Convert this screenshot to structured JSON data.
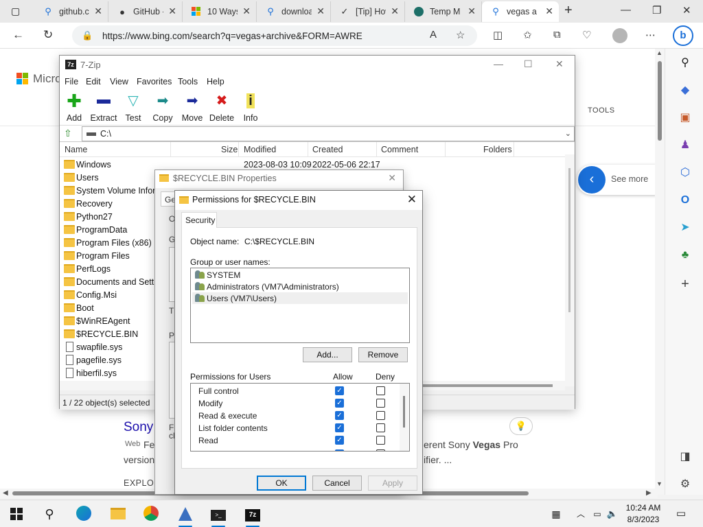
{
  "browser": {
    "tabs": [
      {
        "label": "github.com",
        "icon": "search-icon"
      },
      {
        "label": "GitHub - ",
        "icon": "github-icon"
      },
      {
        "label": "10 Ways",
        "icon": "windows-icon"
      },
      {
        "label": "download",
        "icon": "search-icon"
      },
      {
        "label": "[Tip] How",
        "icon": "tip-icon"
      },
      {
        "label": "Temp Mail",
        "icon": "tempmail-icon"
      },
      {
        "label": "vegas archive",
        "icon": "search-icon"
      }
    ],
    "new_tab_symbol": "+",
    "url": "https://www.bing.com/search?q=vegas+archive&FORM=AWRE"
  },
  "webpage": {
    "logo_text": "Micro",
    "tools_label": "TOOLS",
    "see_more": "See more",
    "result_title": "Sony",
    "result_source": "Web",
    "result_snippet_start": "Fe",
    "snippet_line1_right": "erent Sony ",
    "snippet_bold": "Vegas",
    "snippet_line1_end": " Pro",
    "snippet_line2_left": "version",
    "snippet_line2_right": "ifier. ...",
    "explore": "EXPLOR"
  },
  "sevenzip": {
    "title": "7-Zip",
    "menu": [
      "File",
      "Edit",
      "View",
      "Favorites",
      "Tools",
      "Help"
    ],
    "toolbar": [
      {
        "label": "Add",
        "icon": "add-icon"
      },
      {
        "label": "Extract",
        "icon": "extract-icon"
      },
      {
        "label": "Test",
        "icon": "test-icon"
      },
      {
        "label": "Copy",
        "icon": "copy-icon"
      },
      {
        "label": "Move",
        "icon": "move-icon"
      },
      {
        "label": "Delete",
        "icon": "delete-icon"
      },
      {
        "label": "Info",
        "icon": "info-icon"
      }
    ],
    "path": "C:\\",
    "columns": [
      "Name",
      "Size",
      "Modified",
      "Created",
      "Comment",
      "Folders"
    ],
    "files": [
      {
        "name": "Windows",
        "type": "folder",
        "modified": "2023-08-03 10:09",
        "created": "2022-05-06 22:17"
      },
      {
        "name": "Users",
        "type": "folder",
        "modified": "",
        "created": ""
      },
      {
        "name": "System Volume Information",
        "type": "folder",
        "modified": "",
        "created": ""
      },
      {
        "name": "Recovery",
        "type": "folder",
        "modified": "",
        "created": ""
      },
      {
        "name": "Python27",
        "type": "folder",
        "modified": "",
        "created": ""
      },
      {
        "name": "ProgramData",
        "type": "folder",
        "modified": "",
        "created": ""
      },
      {
        "name": "Program Files (x86)",
        "type": "folder",
        "modified": "",
        "created": ""
      },
      {
        "name": "Program Files",
        "type": "folder",
        "modified": "",
        "created": ""
      },
      {
        "name": "PerfLogs",
        "type": "folder",
        "modified": "",
        "created": ""
      },
      {
        "name": "Documents and Settings",
        "type": "folder",
        "modified": "",
        "created": ""
      },
      {
        "name": "Config.Msi",
        "type": "folder",
        "modified": "",
        "created": ""
      },
      {
        "name": "Boot",
        "type": "folder",
        "modified": "",
        "created": ""
      },
      {
        "name": "$WinREAgent",
        "type": "folder",
        "modified": "",
        "created": ""
      },
      {
        "name": "$RECYCLE.BIN",
        "type": "folder",
        "modified": "",
        "created": ""
      },
      {
        "name": "swapfile.sys",
        "type": "file",
        "modified": "",
        "created": ""
      },
      {
        "name": "pagefile.sys",
        "type": "file",
        "modified": "",
        "created": ""
      },
      {
        "name": "hiberfil.sys",
        "type": "file",
        "modified": "",
        "created": ""
      }
    ],
    "status": "1 / 22 object(s) selected"
  },
  "properties": {
    "title": "$RECYCLE.BIN Properties",
    "tab_fragment": "Ge",
    "fragments": [
      "O",
      "G",
      "T",
      "P",
      "F",
      "cl"
    ]
  },
  "permissions": {
    "title": "Permissions for $RECYCLE.BIN",
    "tab": "Security",
    "object_name_label": "Object name:",
    "object_name": "C:\\$RECYCLE.BIN",
    "group_label": "Group or user names:",
    "users": [
      {
        "name": "SYSTEM",
        "selected": false
      },
      {
        "name": "Administrators (VM7\\Administrators)",
        "selected": false
      },
      {
        "name": "Users (VM7\\Users)",
        "selected": true
      }
    ],
    "add_button": "Add...",
    "remove_button": "Remove",
    "perms_label": "Permissions for Users",
    "allow_label": "Allow",
    "deny_label": "Deny",
    "perms": [
      {
        "name": "Full control",
        "allow": true,
        "deny": false
      },
      {
        "name": "Modify",
        "allow": true,
        "deny": false
      },
      {
        "name": "Read & execute",
        "allow": true,
        "deny": false
      },
      {
        "name": "List folder contents",
        "allow": true,
        "deny": false
      },
      {
        "name": "Read",
        "allow": true,
        "deny": false
      }
    ],
    "ok": "OK",
    "cancel": "Cancel",
    "apply": "Apply"
  },
  "taskbar": {
    "time": "10:24 AM",
    "date": "8/3/2023",
    "apps": [
      "start-icon",
      "search-icon",
      "edge-icon",
      "file-explorer-icon",
      "chrome-icon",
      "app-icon",
      "terminal-icon",
      "sevenzip-icon"
    ]
  },
  "colors": {
    "accent": "#0078d4",
    "checkbox": "#1a6fd8",
    "folder": "#f5c443",
    "link": "#1a0dab"
  }
}
